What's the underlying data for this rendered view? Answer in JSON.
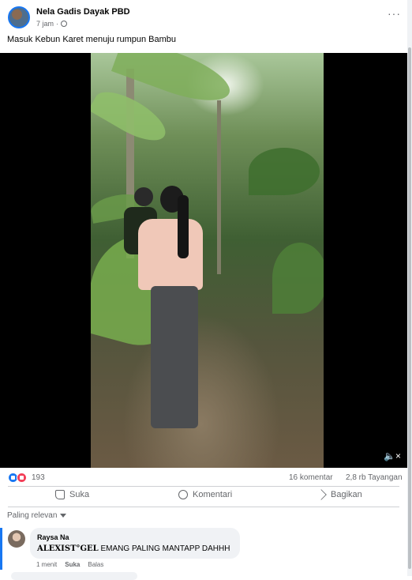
{
  "post": {
    "author": "Nela Gadis Dayak PBD",
    "time": "7 jam",
    "privacy_icon": "globe-icon",
    "more_icon": "more-options-icon",
    "caption": "Masuk Kebun Karet menuju rumpun Bambu"
  },
  "video": {
    "sound_icon": "speaker-muted-icon"
  },
  "stats": {
    "reaction_icons": [
      "like-icon",
      "love-icon"
    ],
    "reactions": "193",
    "comments": "16 komentar",
    "views": "2,8 rb Tayangan"
  },
  "actions": {
    "like": "Suka",
    "comment": "Komentari",
    "share": "Bagikan"
  },
  "sort": {
    "label": "Paling relevan"
  },
  "comments": [
    {
      "name": "Raysa Na",
      "tag": "𝐀𝐋𝐄𝐗𝐈𝐒𝐓°𝐆𝐄𝐋",
      "text": " EMANG PALING MANTAPP DAHHH",
      "time": "1 menit",
      "like": "Suka",
      "reply": "Balas"
    }
  ],
  "colors": {
    "accent": "#1877f2",
    "love": "#f33e58",
    "muted_text": "#65676b",
    "bubble_bg": "#f0f2f5"
  }
}
